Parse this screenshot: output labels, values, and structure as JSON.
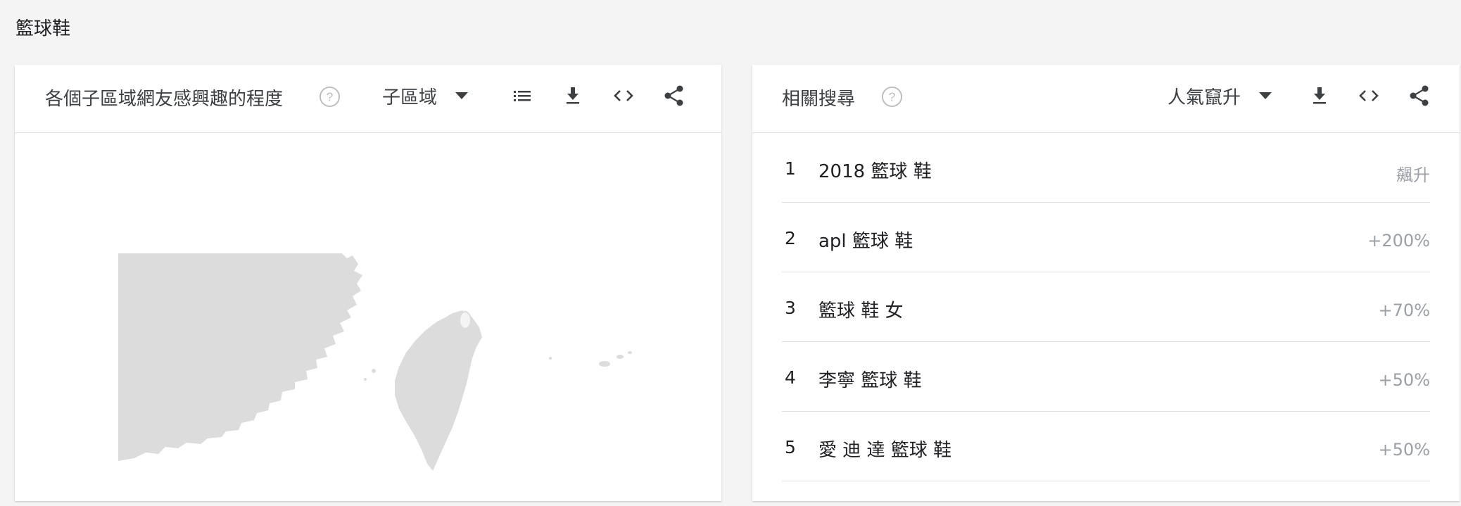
{
  "page": {
    "title": "籃球鞋"
  },
  "left_card": {
    "title": "各個子區域網友感興趣的程度",
    "dropdown_label": "子區域"
  },
  "right_card": {
    "title": "相關搜尋",
    "dropdown_label": "人氣竄升",
    "rows": [
      {
        "rank": "1",
        "term": "2018 籃球 鞋",
        "value": "飆升"
      },
      {
        "rank": "2",
        "term": "apl 籃球 鞋",
        "value": "+200%"
      },
      {
        "rank": "3",
        "term": "籃球 鞋 女",
        "value": "+70%"
      },
      {
        "rank": "4",
        "term": "李寧 籃球 鞋",
        "value": "+50%"
      },
      {
        "rank": "5",
        "term": "愛 迪 達 籃球 鞋",
        "value": "+50%"
      }
    ]
  },
  "icons": {
    "help": "help-circle-icon",
    "list": "list-icon",
    "download": "download-icon",
    "embed": "embed-code-icon",
    "share": "share-icon"
  },
  "colors": {
    "map_fill": "#dcdcdc",
    "icon_gray": "#3c4043",
    "muted_text": "#9aa0a6"
  }
}
